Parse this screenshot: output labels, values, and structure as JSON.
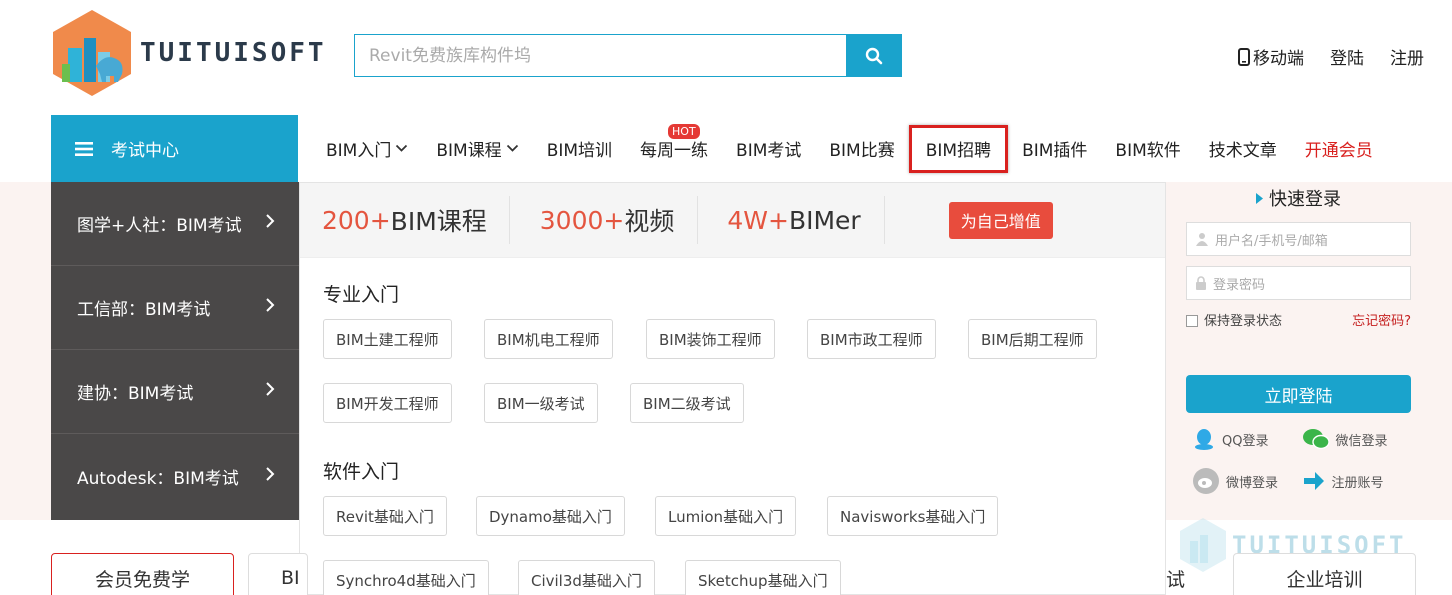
{
  "logo": {
    "text": "TUITUISOFT"
  },
  "search": {
    "placeholder": "Revit免费族库构件坞"
  },
  "top_links": {
    "mobile": "移动端",
    "login": "登陆",
    "register": "注册"
  },
  "category": {
    "header": "考试中心",
    "items": [
      {
        "label": "图学+人社：BIM考试"
      },
      {
        "label": "工信部：BIM考试"
      },
      {
        "label": "建协：BIM考试"
      },
      {
        "label": "Autodesk：BIM考试"
      }
    ]
  },
  "nav": {
    "items": [
      {
        "label": "BIM入门",
        "dropdown": true
      },
      {
        "label": "BIM课程",
        "dropdown": true
      },
      {
        "label": "BIM培训"
      },
      {
        "label": "每周一练",
        "badge": "HOT"
      },
      {
        "label": "BIM考试"
      },
      {
        "label": "BIM比赛"
      },
      {
        "label": "BIM招聘",
        "highlighted": true
      },
      {
        "label": "BIM插件"
      },
      {
        "label": "BIM软件"
      },
      {
        "label": "技术文章"
      },
      {
        "label": "开通会员",
        "color": "#d9211f"
      }
    ]
  },
  "stats": {
    "courses_num": "200+",
    "courses_label": "BIM课程",
    "videos_num": "3000+",
    "videos_label": "视频",
    "users_num": "4W+",
    "users_label": "BIMer",
    "button": "为自己增值"
  },
  "sections": {
    "professional": {
      "title": "专业入门",
      "tags": [
        "BIM土建工程师",
        "BIM机电工程师",
        "BIM装饰工程师",
        "BIM市政工程师",
        "BIM后期工程师",
        "BIM开发工程师",
        "BIM一级考试",
        "BIM二级考试"
      ]
    },
    "software": {
      "title": "软件入门",
      "tags": [
        "Revit基础入门",
        "Dynamo基础入门",
        "Lumion基础入门",
        "Navisworks基础入门",
        "Synchro4d基础入门",
        "Civil3d基础入门",
        "Sketchup基础入门"
      ]
    }
  },
  "login": {
    "title": "快速登录",
    "username_placeholder": "用户名/手机号/邮箱",
    "password_placeholder": "登录密码",
    "remember": "保持登录状态",
    "forgot": "忘记密码?",
    "submit": "立即登陆",
    "qq": "QQ登录",
    "wechat": "微信登录",
    "weibo": "微博登录",
    "register": "注册账号"
  },
  "bottom": {
    "member_free": "会员免费学",
    "partial_left": "BI",
    "partial_right": "试",
    "enterprise": "企业培训"
  },
  "colors": {
    "accent": "#1aa3cc",
    "red": "#d9211f",
    "sidebar": "#4a4848"
  }
}
